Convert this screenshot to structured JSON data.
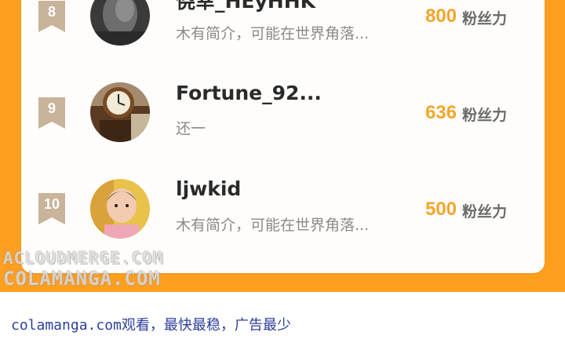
{
  "leaderboard": {
    "rows": [
      {
        "rank": "8",
        "name": "侥幸_HEyHHK",
        "bio": "木有简介，可能在世界角落...",
        "count": "800",
        "unit": "粉丝力",
        "avatar": "dark-portrait-avatar"
      },
      {
        "rank": "9",
        "name": "Fortune_92...",
        "bio": "还一",
        "count": "636",
        "unit": "粉丝力",
        "avatar": "clock-avatar"
      },
      {
        "rank": "10",
        "name": "ljwkid",
        "bio": "木有简介，可能在世界角落...",
        "count": "500",
        "unit": "粉丝力",
        "avatar": "child-photo-avatar"
      }
    ]
  },
  "watermark": {
    "line1": "ACLOUDMERGE.COM",
    "line2": "COLAMANGA.COM"
  },
  "footer": {
    "text": "colamanga.com观看，最快最稳，广告最少"
  },
  "colors": {
    "accent_orange": "#ff9f1f",
    "count_gold": "#f3a62b",
    "rank_badge": "#c9b39a",
    "footer_link_blue": "#2d3f9e"
  }
}
